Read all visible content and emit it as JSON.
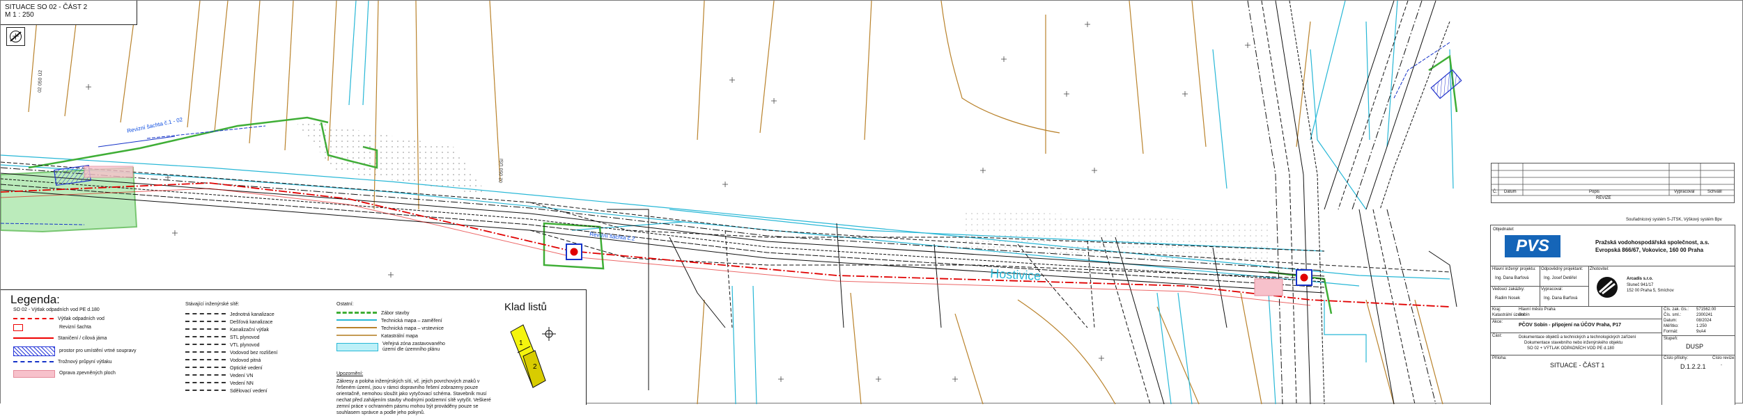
{
  "sheet": {
    "title": "SITUACE SO 02 - ČÁST 2",
    "scale": "M 1 : 250"
  },
  "legend": {
    "title": "Legenda:",
    "klad_title": "Klad listů",
    "group_left_heading": "SO 02 - Výtlak odpadních vod PE d.180",
    "items_left": [
      "Výtlak odpadních vod",
      "Revizní šachta",
      "Staničení / cílová jáma",
      "prostor pro umístění vrtné soupravy",
      "Trožnový průpyní výtlaku",
      "Oprava zpevněných ploch"
    ],
    "group_mid_heading": "Stávající inženýrské sítě:",
    "items_mid": [
      "Jednotná kanalizace",
      "Dešťová kanalizace",
      "Kanalizační výtlak",
      "STL plynovod",
      "VTL plynovod",
      "Vodovod bez rozlišení",
      "Vodovod pitná",
      "Optické vedení",
      "Vedení VN",
      "Vedení NN",
      "Sdělovací vedení"
    ],
    "group_right_heading": "Ostatní:",
    "items_right": [
      "Zábor stavby",
      "Technická mapa – zaměření",
      "Technická mapa – vrstevnice",
      "Katastrální mapa",
      "Veřejná zóna zastavovaného území dle územního plánu"
    ],
    "note_title": "Upozornění:",
    "note_text": "Zákresy a poloha inženýrských sítí, vč. jejich povrchových znaků v řešeném území, jsou v rámci dopravního řešení zobrazeny pouze orientačně, nemohou sloužit jako vytyčovací schéma. Stavebník musí nechat před zahájením stavby vhodnými podzemní sítě vytyčit. Veškeré zemní práce v ochranném pásmu mohou být prováděny pouze se souhlasem správce a podle jeho pokynů.",
    "klad_labels": [
      "1",
      "2"
    ]
  },
  "map_labels": {
    "street": "Hostivice",
    "cad1": "02 050 ÚSI",
    "cad2": "02 050 Ú2",
    "revision_label_1": "Revizní šachta č.1 - 02",
    "revision_label_2": "Revizní šachta č.2"
  },
  "revize": {
    "caption": "REVIZE",
    "columns": [
      "Č.",
      "Datum",
      "Popis",
      "Vypracoval",
      "Schválil"
    ]
  },
  "coordinate_system": "Souřadnicový systém S-JTSK, Výškový systém Bpv",
  "title_block": {
    "investor_label": "Objednatel:",
    "investor_name": "Pražská vodohospodářská společnost, a.s.",
    "investor_address": "Evropská 866/67, Vokovice, 160 00 Praha",
    "logo_text": "PVS",
    "roles": [
      {
        "label": "Hlavní inženýr projektu:",
        "value": "Ing. Dana Barfová"
      },
      {
        "label": "Odpovědný projektant:",
        "value": "Ing. Josef Detěřel"
      },
      {
        "label": "Vedoucí zakázky:",
        "value": "Radim Nosek"
      },
      {
        "label": "Vypracoval:",
        "value": "Ing. Dana Barfová"
      }
    ],
    "designer_label": "Zhotovitel:",
    "designer_name": "Arcadis s.r.o.",
    "designer_address_1": "Sluneč 941/17",
    "designer_address_2": "152 00 Praha 5, Smíchov",
    "place_label": "Kraj:",
    "place_value": "Hlavní město Praha",
    "city_label": "Katastrální území:",
    "city_value": "Sobín",
    "project_label": "Akce:",
    "project_name": "PČOV Sobín - připojení na ÚČOV Praha, P17",
    "part_label": "Část:",
    "part_lines": [
      "Dokumentace objektů a technických a technologických zařízení",
      "Dokumentace stavebního nebo inženýrského objektu",
      "SO 02 + VÝTLAK ODPADNÍCH VOD PE d.180"
    ],
    "drawing_label": "Příloha:",
    "drawing_name": "SITUACE - ČÁST 1",
    "meta": [
      {
        "label": "Čís. zak. čís.:",
        "value": "571562.00"
      },
      {
        "label": "Čís. sml.:",
        "value": "2300241"
      },
      {
        "label": "Datum:",
        "value": "08/2024"
      },
      {
        "label": "Měřítko:",
        "value": "1:250"
      },
      {
        "label": "Formát:",
        "value": "9xA4"
      }
    ],
    "stage_label": "Stupeň:",
    "stage_value": "DUSP",
    "number_label": "Číslo přílohy:",
    "number_value": "D.1.2.2.1",
    "revision_label": "Číslo revize:",
    "revision_value": "-"
  },
  "colors": {
    "red": "#e00000",
    "cyan": "#27b7d6",
    "brown": "#b9822b",
    "green": "#3fae36",
    "blue": "#1533c8",
    "pvs_blue": "#1565b8"
  }
}
